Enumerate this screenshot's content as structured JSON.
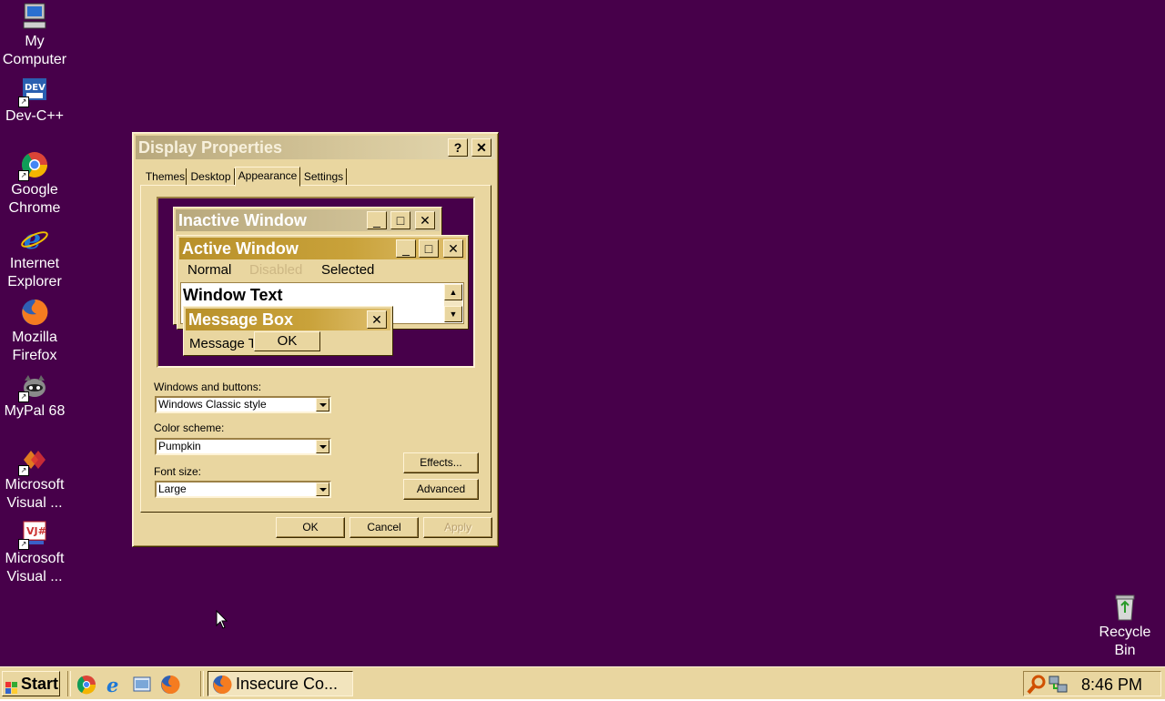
{
  "desktop": {
    "icons": [
      {
        "label": "My Computer"
      },
      {
        "label": "Dev-C++"
      },
      {
        "label": "Google Chrome"
      },
      {
        "label": "Internet Explorer"
      },
      {
        "label": "Mozilla Firefox"
      },
      {
        "label": "MyPal 68"
      },
      {
        "label": "Microsoft Visual ..."
      },
      {
        "label": "Microsoft Visual ..."
      },
      {
        "label": "Recycle Bin"
      }
    ]
  },
  "dialog": {
    "title": "Display Properties",
    "help_btn": "?",
    "close_btn": "✕",
    "tabs": [
      "Themes",
      "Desktop",
      "Appearance",
      "Settings"
    ],
    "preview": {
      "inactive_title": "Inactive Window",
      "active_title": "Active Window",
      "menu_normal": "Normal",
      "menu_disabled": "Disabled",
      "menu_selected": "Selected",
      "window_text": "Window Text",
      "msg_title": "Message Box",
      "msg_text": "Message Text",
      "msg_ok": "OK"
    },
    "windows_buttons_label": "Windows and buttons:",
    "windows_buttons_value": "Windows Classic style",
    "color_scheme_label": "Color scheme:",
    "color_scheme_value": "Pumpkin",
    "font_size_label": "Font size:",
    "font_size_value": "Large",
    "effects_btn": "Effects...",
    "advanced_btn": "Advanced",
    "ok_btn": "OK",
    "cancel_btn": "Cancel",
    "apply_btn": "Apply"
  },
  "taskbar": {
    "start": "Start",
    "task": "Insecure Co...",
    "clock": "8:46 PM"
  },
  "colors": {
    "desktop": "#47004a",
    "face": "#e9d6a0",
    "active_title": "#c9a23a"
  }
}
